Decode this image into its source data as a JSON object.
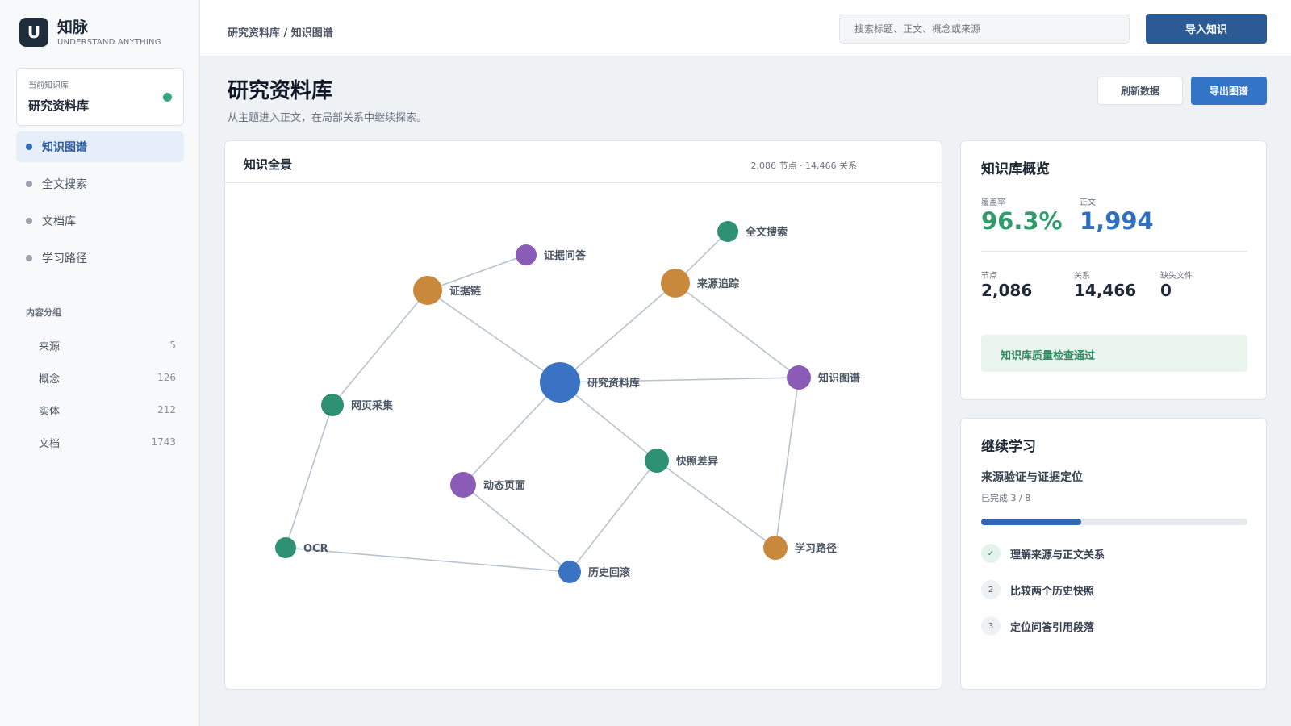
{
  "brand": {
    "logo_letter": "U",
    "name": "知脉",
    "tagline": "UNDERSTAND ANYTHING"
  },
  "current_kb": {
    "label": "当前知识库",
    "name": "研究资料库",
    "status_color": "#34a87a"
  },
  "nav": [
    {
      "label": "知识图谱",
      "active": true
    },
    {
      "label": "全文搜索",
      "active": false
    },
    {
      "label": "文档库",
      "active": false
    },
    {
      "label": "学习路径",
      "active": false
    }
  ],
  "groups": {
    "title": "内容分组",
    "items": [
      {
        "label": "来源",
        "count": "5"
      },
      {
        "label": "概念",
        "count": "126"
      },
      {
        "label": "实体",
        "count": "212"
      },
      {
        "label": "文档",
        "count": "1743"
      }
    ]
  },
  "topbar": {
    "breadcrumb": "研究资料库 / 知识图谱",
    "search_placeholder": "搜索标题、正文、概念或来源",
    "import_label": "导入知识"
  },
  "page": {
    "title": "研究资料库",
    "subtitle": "从主题进入正文，在局部关系中继续探索。",
    "refresh_label": "刷新数据",
    "export_label": "导出图谱"
  },
  "graph": {
    "title": "知识全景",
    "stats": "2,086 节点 · 14,466 关系",
    "colors": {
      "concept": "#2e9272",
      "source": "#c9893d",
      "entity": "#8a5cb8",
      "hub": "#3a73c4",
      "doc": "#3a73c4",
      "edge": "#b7c3d0"
    },
    "nodes": [
      {
        "id": "hub",
        "label": "研究资料库",
        "kind": "hub"
      },
      {
        "id": "evidence_chain",
        "label": "证据链",
        "kind": "source"
      },
      {
        "id": "evidence_qa",
        "label": "证据问答",
        "kind": "entity"
      },
      {
        "id": "fulltext",
        "label": "全文搜索",
        "kind": "concept"
      },
      {
        "id": "source_trace",
        "label": "来源追踪",
        "kind": "source"
      },
      {
        "id": "kgraph",
        "label": "知识图谱",
        "kind": "entity"
      },
      {
        "id": "web_crawl",
        "label": "网页采集",
        "kind": "concept"
      },
      {
        "id": "dynamic_page",
        "label": "动态页面",
        "kind": "entity"
      },
      {
        "id": "snapshot_diff",
        "label": "快照差异",
        "kind": "concept"
      },
      {
        "id": "ocr",
        "label": "OCR",
        "kind": "concept"
      },
      {
        "id": "rollback",
        "label": "历史回滚",
        "kind": "doc"
      },
      {
        "id": "learn_path",
        "label": "学习路径",
        "kind": "source"
      }
    ],
    "edges": [
      [
        "evidence_chain",
        "evidence_qa"
      ],
      [
        "evidence_chain",
        "hub"
      ],
      [
        "evidence_chain",
        "web_crawl"
      ],
      [
        "fulltext",
        "source_trace"
      ],
      [
        "source_trace",
        "hub"
      ],
      [
        "source_trace",
        "kgraph"
      ],
      [
        "hub",
        "kgraph"
      ],
      [
        "hub",
        "dynamic_page"
      ],
      [
        "hub",
        "snapshot_diff"
      ],
      [
        "web_crawl",
        "ocr"
      ],
      [
        "ocr",
        "rollback"
      ],
      [
        "dynamic_page",
        "rollback"
      ],
      [
        "snapshot_diff",
        "rollback"
      ],
      [
        "snapshot_diff",
        "learn_path"
      ],
      [
        "kgraph",
        "learn_path"
      ]
    ]
  },
  "overview": {
    "title": "知识库概览",
    "coverage_label": "覆盖率",
    "coverage_value": "96.3%",
    "docs_label": "正文",
    "docs_value": "1,994",
    "nodes_label": "节点",
    "nodes_value": "2,086",
    "relations_label": "关系",
    "relations_value": "14,466",
    "missing_label": "缺失文件",
    "missing_value": "0",
    "quality_text": "知识库质量检查通过",
    "coverage_color": "#2f9a6a",
    "docs_color": "#2f6fc2"
  },
  "learning": {
    "title": "继续学习",
    "topic": "来源验证与证据定位",
    "progress_text": "已完成 3 / 8",
    "progress_fraction": 0.375,
    "steps": [
      {
        "badge": "✓",
        "label": "理解来源与正文关系",
        "done": true
      },
      {
        "badge": "2",
        "label": "比较两个历史快照",
        "done": false
      },
      {
        "badge": "3",
        "label": "定位问答引用段落",
        "done": false
      }
    ]
  }
}
